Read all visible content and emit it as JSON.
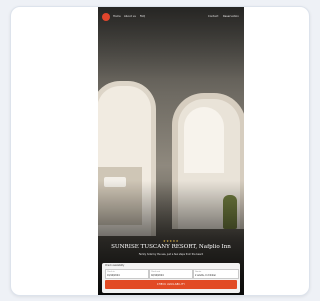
{
  "nav": {
    "links": [
      "Home",
      "About us",
      "FAQ"
    ],
    "right_links": [
      "Contact",
      "Reservation"
    ]
  },
  "hero": {
    "stars": "★★★★★",
    "title": "SUNRISE TUSCANY RESORT, Nafplio Inn",
    "subtitle": "Family hotel by the sea, just a few steps from the beach"
  },
  "booking": {
    "heading": "Check availability",
    "fields": [
      {
        "label": "Check in",
        "value": "01/10/2024"
      },
      {
        "label": "Check out",
        "value": "02/10/2024"
      },
      {
        "label": "Guests",
        "value": "2 adults, 0 children"
      }
    ],
    "cta_label": "CHECK AVAILABILITY"
  },
  "colors": {
    "accent": "#e24b25",
    "logo": "#e0452c"
  }
}
